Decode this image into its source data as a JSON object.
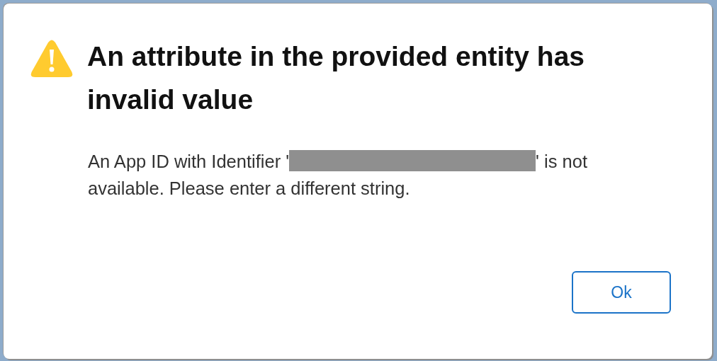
{
  "dialog": {
    "title": "An attribute in the provided entity has invalid value",
    "message_before": "An App ID with Identifier '",
    "message_after": "' is not available. Please enter a different string.",
    "buttons": [
      {
        "label": "Ok",
        "kind": "default"
      }
    ]
  }
}
